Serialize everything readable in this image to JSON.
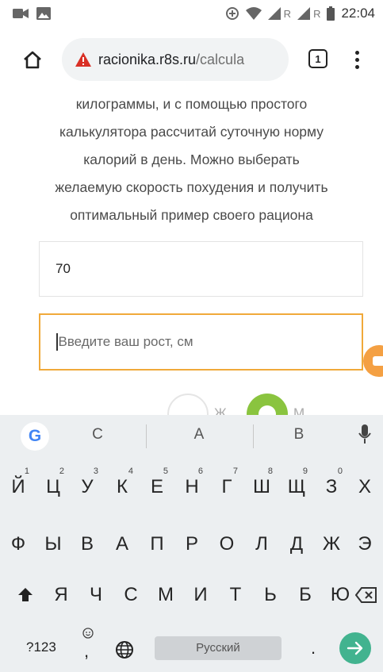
{
  "status_bar": {
    "time": "22:04",
    "network_1": "R",
    "network_2": "R"
  },
  "browser": {
    "url_host": "racionika.r8s.ru",
    "url_path": "/calcula",
    "tab_count": "1"
  },
  "page": {
    "intro_lines": [
      "килограммы, и с помощью простого",
      "калькулятора рассчитай суточную норму",
      "калорий в день. Можно выберать",
      "желаемую скорость похудения и получить",
      "оптимальный пример своего рациона"
    ],
    "weight_value": "70",
    "height_placeholder": "Введите ваш рост, см",
    "gender_female": "Ж",
    "gender_male": "М"
  },
  "keyboard": {
    "suggestions": [
      "С",
      "А",
      "В"
    ],
    "row1": [
      {
        "k": "Й",
        "n": "1"
      },
      {
        "k": "Ц",
        "n": "2"
      },
      {
        "k": "У",
        "n": "3"
      },
      {
        "k": "К",
        "n": "4"
      },
      {
        "k": "Е",
        "n": "5"
      },
      {
        "k": "Н",
        "n": "6"
      },
      {
        "k": "Г",
        "n": "7"
      },
      {
        "k": "Ш",
        "n": "8"
      },
      {
        "k": "Щ",
        "n": "9"
      },
      {
        "k": "З",
        "n": "0"
      },
      {
        "k": "Х",
        "n": ""
      }
    ],
    "row2": [
      "Ф",
      "Ы",
      "В",
      "А",
      "П",
      "Р",
      "О",
      "Л",
      "Д",
      "Ж",
      "Э"
    ],
    "row3": [
      "Я",
      "Ч",
      "С",
      "М",
      "И",
      "Т",
      "Ь",
      "Б",
      "Ю"
    ],
    "symbols_label": "?123",
    "comma_label": ",",
    "space_label": "Русский",
    "period_label": ".",
    "accent_color": "#42b38f"
  }
}
